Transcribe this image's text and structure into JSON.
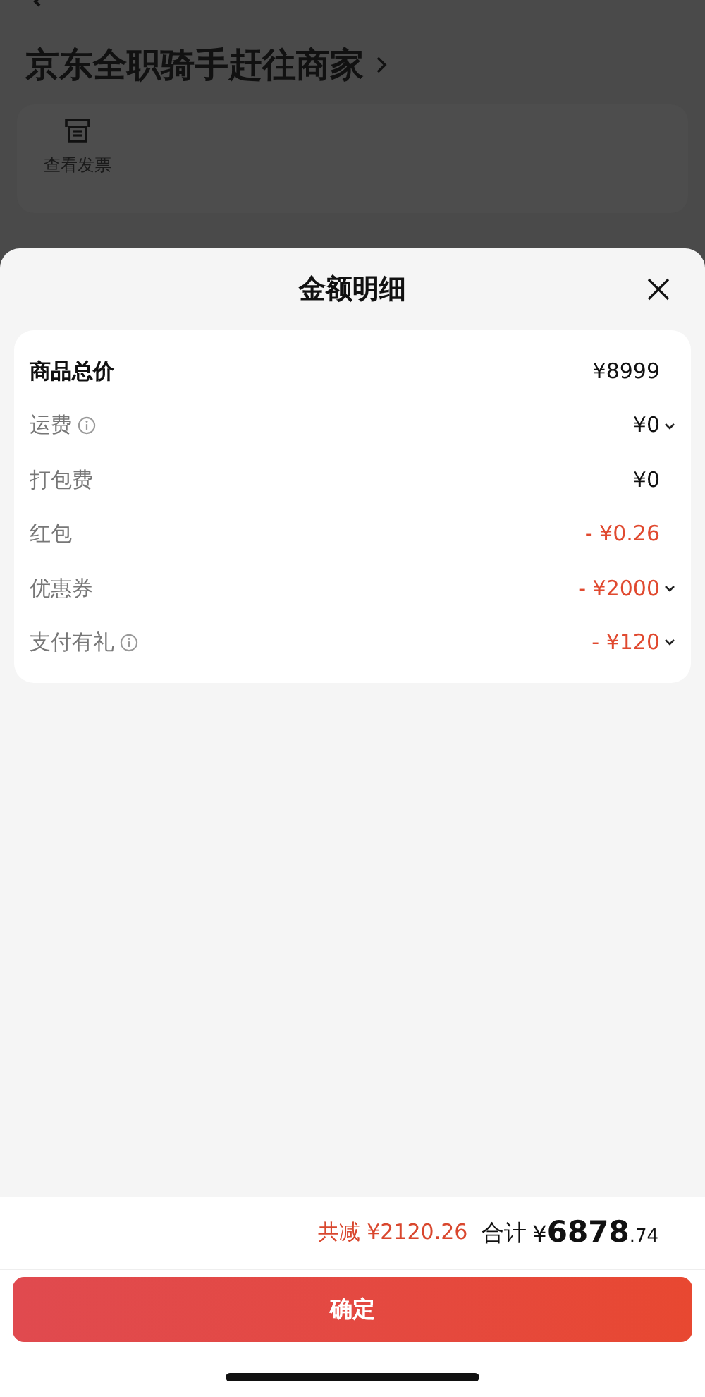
{
  "background": {
    "title": "京东全职骑手赶往商家",
    "actions": [
      {
        "label": "查看发票"
      }
    ]
  },
  "sheet": {
    "title": "金额明细",
    "rows": [
      {
        "label": "商品总价",
        "value": "¥8999",
        "bold": true,
        "info": false,
        "discount": false,
        "expandable": false
      },
      {
        "label": "运费",
        "value": "¥0",
        "bold": false,
        "info": true,
        "discount": false,
        "expandable": true
      },
      {
        "label": "打包费",
        "value": "¥0",
        "bold": false,
        "info": false,
        "discount": false,
        "expandable": false
      },
      {
        "label": "红包",
        "value": "- ¥0.26",
        "bold": false,
        "info": false,
        "discount": true,
        "expandable": false
      },
      {
        "label": "优惠券",
        "value": "- ¥2000",
        "bold": false,
        "info": false,
        "discount": true,
        "expandable": true
      },
      {
        "label": "支付有礼",
        "value": "- ¥120",
        "bold": false,
        "info": true,
        "discount": true,
        "expandable": true
      }
    ]
  },
  "footer": {
    "reduction": "共减 ¥2120.26",
    "total_label": "合计",
    "total_currency": "¥",
    "total_integer": "6878",
    "total_decimal": ".74",
    "confirm_button": "确定"
  }
}
